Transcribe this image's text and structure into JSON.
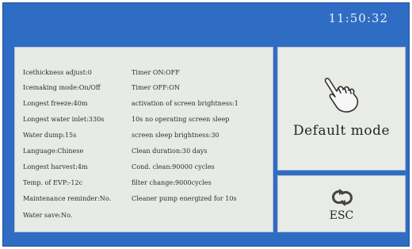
{
  "clock": {
    "time": "11:50:32"
  },
  "settings": {
    "left": [
      "Icethickness adjust:0",
      "Icemaking mode:On/Off",
      "Longest freeze:40m",
      "Longest water inlet:330s",
      "Water dump:15s",
      "Language:Chinese",
      "Longest harvest:4m",
      "Temp. of EVP:-12c",
      "Maintenance reminder:No.",
      "Water save:No."
    ],
    "right": [
      "Timer ON:OFF",
      "Timer OFF:ON",
      "activation of screen brightness:1",
      "10s no operating screen sleep",
      "screen sleep brightness:30",
      "Clean duration:30 days",
      "Cond. clean:90000 cycles",
      "filter change:9000cycles",
      "Cleaner pump energized for 10s"
    ]
  },
  "buttons": {
    "default_mode": {
      "label": "Default mode",
      "icon": "pointing-hand-icon"
    },
    "esc": {
      "label": "ESC",
      "icon": "cycle-arrows-icon"
    }
  },
  "colors": {
    "background": "#2f6cc4",
    "panel": "#e7ebe5",
    "clock_text": "#e9eef7"
  }
}
